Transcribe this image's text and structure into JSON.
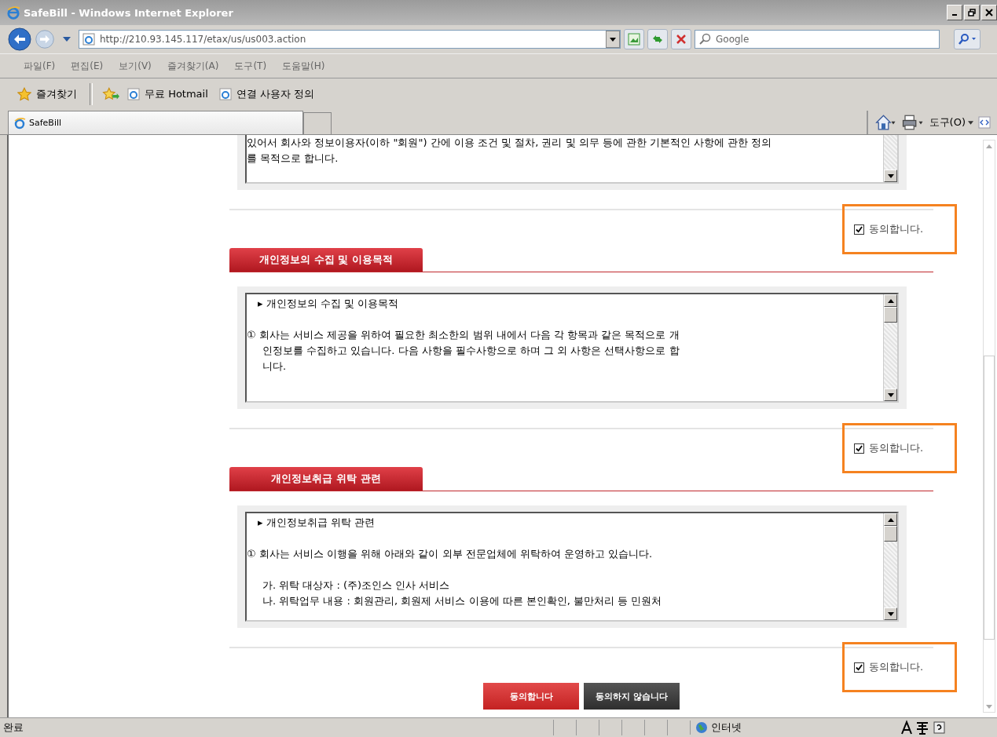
{
  "window": {
    "title": "SafeBill - Windows Internet Explorer"
  },
  "address_bar": {
    "url": "http://210.93.145.117/etax/us/us003.action"
  },
  "search": {
    "placeholder": "Google"
  },
  "menu": [
    "파일(F)",
    "편집(E)",
    "보기(V)",
    "즐겨찾기(A)",
    "도구(T)",
    "도움말(H)"
  ],
  "favorites_bar": {
    "title": "즐겨찾기",
    "links": [
      "무료 Hotmail",
      "연결 사용자 정의"
    ]
  },
  "tabs": [
    {
      "label": "SafeBill",
      "selected": true
    }
  ],
  "command_bar": {
    "tools": "도구(O)"
  },
  "sections": [
    {
      "paragraphs": [
        [
          {
            "kind": "para",
            "text": "있어서 회사와 정보이용자(이하 \"회원\") 간에 이용 조건 및 절차, 권리 및 의무 등에 관한 기본적인 사항에 관한 정의"
          },
          {
            "kind": "para",
            "text": "를 목적으로 합니다."
          }
        ]
      ],
      "agree": {
        "label": "동의합니다.",
        "checked": true
      }
    },
    {
      "heading": "개인정보의 수집 및 이용목적",
      "paragraphs": [
        [
          {
            "kind": "title",
            "text": "▸ 개인정보의 수집 및 이용목적"
          }
        ],
        [
          {
            "kind": "para",
            "text": "① 회사는 서비스 제공을 위하여 필요한 최소한의 범위 내에서 다음 각 항목과 같은 목적으로 개"
          },
          {
            "kind": "cont",
            "text": "인정보를 수집하고 있습니다. 다음 사항을 필수사항으로 하며 그 외 사항은 선택사항으로 합"
          },
          {
            "kind": "cont",
            "text": "니다."
          }
        ]
      ],
      "agree": {
        "label": "동의합니다.",
        "checked": true
      }
    },
    {
      "heading": "개인정보취급 위탁 관련",
      "paragraphs": [
        [
          {
            "kind": "title",
            "text": "▸ 개인정보취급 위탁 관련"
          }
        ],
        [
          {
            "kind": "para",
            "text": "① 회사는 서비스 이행을 위해 아래와 같이 외부 전문업체에 위탁하여 운영하고 있습니다."
          }
        ],
        [
          {
            "kind": "item",
            "text": "가. 위탁 대상자 : (주)조인스 인사 서비스"
          },
          {
            "kind": "item",
            "text": "나. 위탁업무 내용 : 회원관리, 회원제 서비스 이용에 따른 본인확인, 불만처리 등 민원처"
          }
        ]
      ],
      "agree": {
        "label": "동의합니다.",
        "checked": true
      }
    }
  ],
  "buttons": [
    {
      "label": "동의합니다",
      "kind": "primary"
    },
    {
      "label": "동의하지 않습니다",
      "kind": "secondary"
    }
  ],
  "status_bar": {
    "text": "완료",
    "zone": "인터넷"
  }
}
